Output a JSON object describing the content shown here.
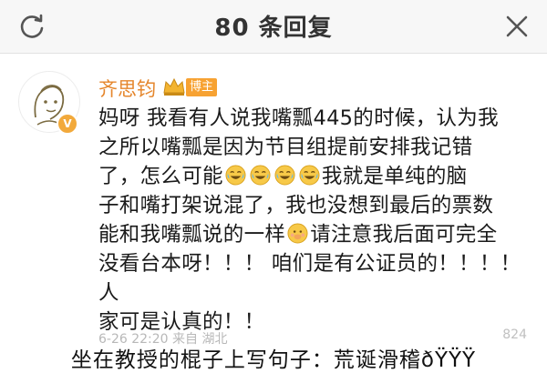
{
  "header": {
    "title": "80 条回复",
    "refresh_icon": "refresh-icon",
    "close_icon": "close-icon"
  },
  "post": {
    "author": "齐思钧",
    "author_color": "#e5862c",
    "host_tag": "博主",
    "verified_badge": "V",
    "content_lines": [
      "妈呀 我看有人说我嘴瓢445的时候，认为我",
      "之所以嘴瓢是因为节目组提前安排我记错",
      [
        "了，怎么可能",
        "😂😂😂😂",
        "我就是单纯的脑"
      ],
      "子和嘴打架说混了，我也没想到最后的票数",
      [
        "能和我嘴瓢说的一样",
        "🤭",
        "请注意我后面可完全"
      ],
      "没看台本呀！！！ 咱们是有公证员的！！！！ 人",
      "家可是认真的！！"
    ],
    "meta": "6-26 22:20 来自 湖北",
    "like_count": "824"
  },
  "caption": "坐在教授的棍子上写句子：荒诞滑稽ðŸŸŸ"
}
